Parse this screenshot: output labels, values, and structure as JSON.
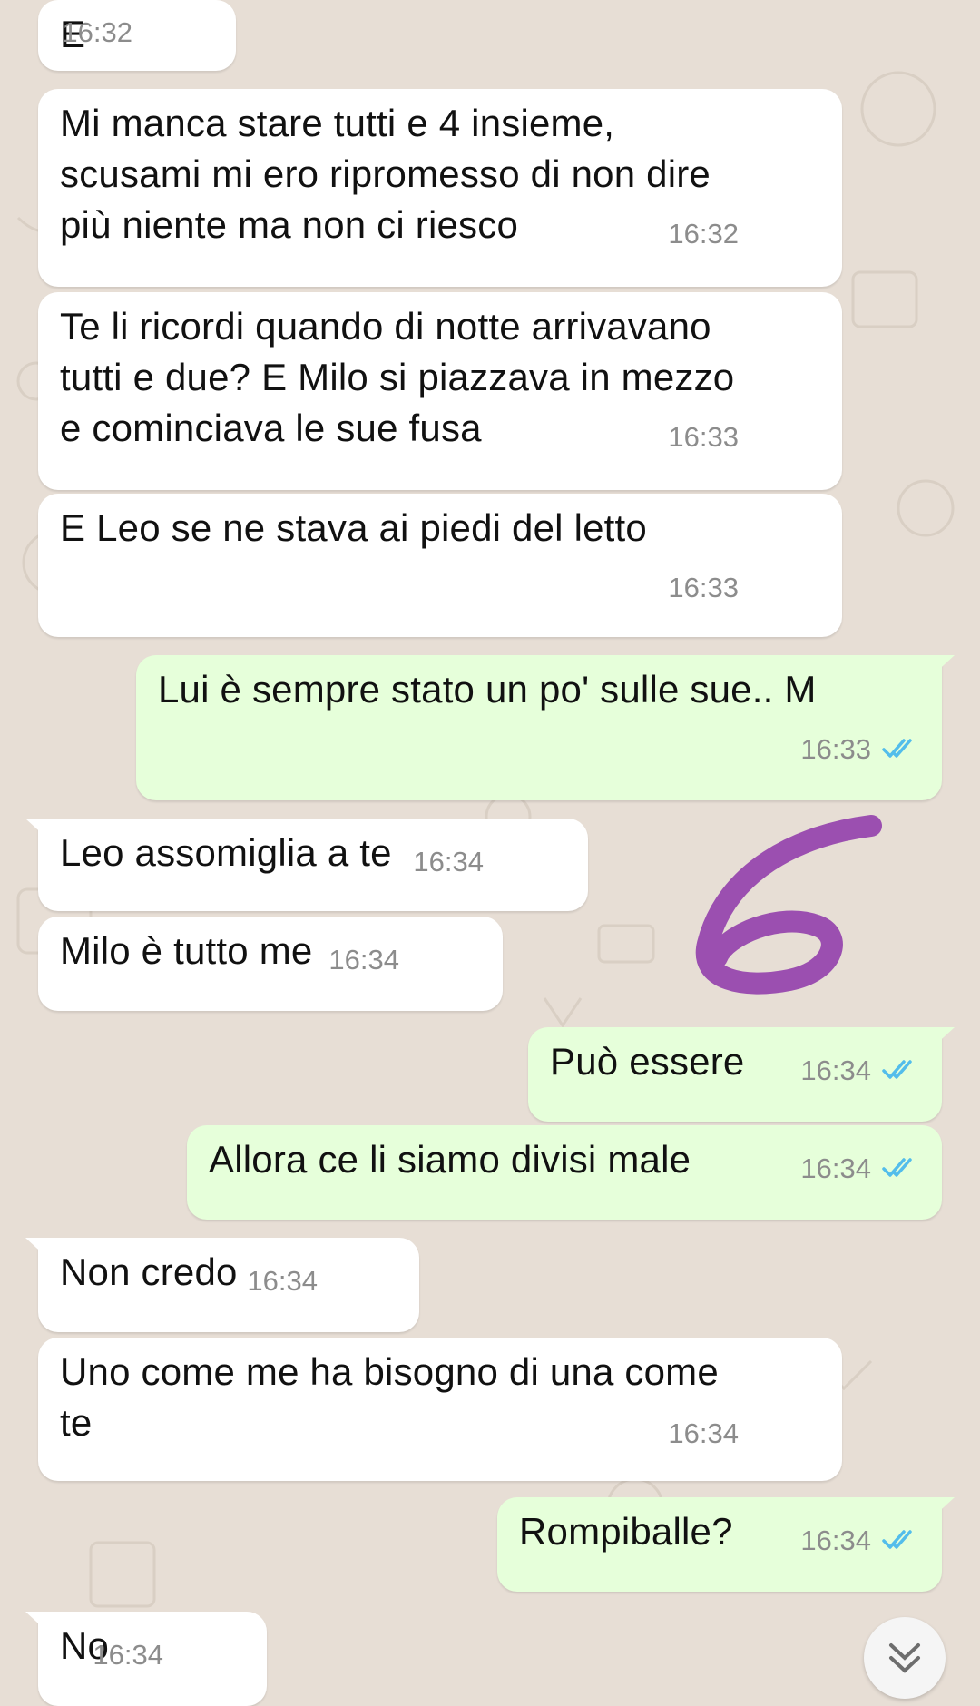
{
  "colors": {
    "background": "#e7ded5",
    "incoming_bubble": "#ffffff",
    "outgoing_bubble": "#e6ffda",
    "read_ticks": "#53bdeb",
    "annotation_stroke": "#9b4fb0"
  },
  "messages": [
    {
      "dir": "in",
      "text": "E",
      "time": "16:32"
    },
    {
      "dir": "in",
      "lines": [
        "Mi manca stare tutti e 4 insieme,",
        "scusami mi ero ripromesso di non dire",
        "più niente ma non ci riesco"
      ],
      "time": "16:32"
    },
    {
      "dir": "in",
      "lines": [
        "Te li ricordi quando di notte arrivavano",
        "tutti e due? E Milo si piazzava in mezzo",
        "e cominciava le sue fusa"
      ],
      "time": "16:33"
    },
    {
      "dir": "in",
      "text": "E Leo se ne stava ai piedi del letto",
      "time": "16:33"
    },
    {
      "dir": "out",
      "text": "Lui è sempre stato un po' sulle sue.. M",
      "time": "16:33",
      "status": "read"
    },
    {
      "dir": "in",
      "text": "Leo assomiglia a te",
      "time": "16:34"
    },
    {
      "dir": "in",
      "text": "Milo è tutto me",
      "time": "16:34"
    },
    {
      "dir": "out",
      "text": "Può essere",
      "time": "16:34",
      "status": "read"
    },
    {
      "dir": "out",
      "text": "Allora ce li siamo divisi male",
      "time": "16:34",
      "status": "read"
    },
    {
      "dir": "in",
      "text": "Non credo",
      "time": "16:34"
    },
    {
      "dir": "in",
      "lines": [
        "Uno come me ha bisogno di una come",
        "te"
      ],
      "time": "16:34"
    },
    {
      "dir": "out",
      "text": "Rompiballe?",
      "time": "16:34",
      "status": "read"
    },
    {
      "dir": "in",
      "text": "No",
      "time": "16:34"
    }
  ],
  "scroll_down_icon": "chevron-double-down-icon"
}
